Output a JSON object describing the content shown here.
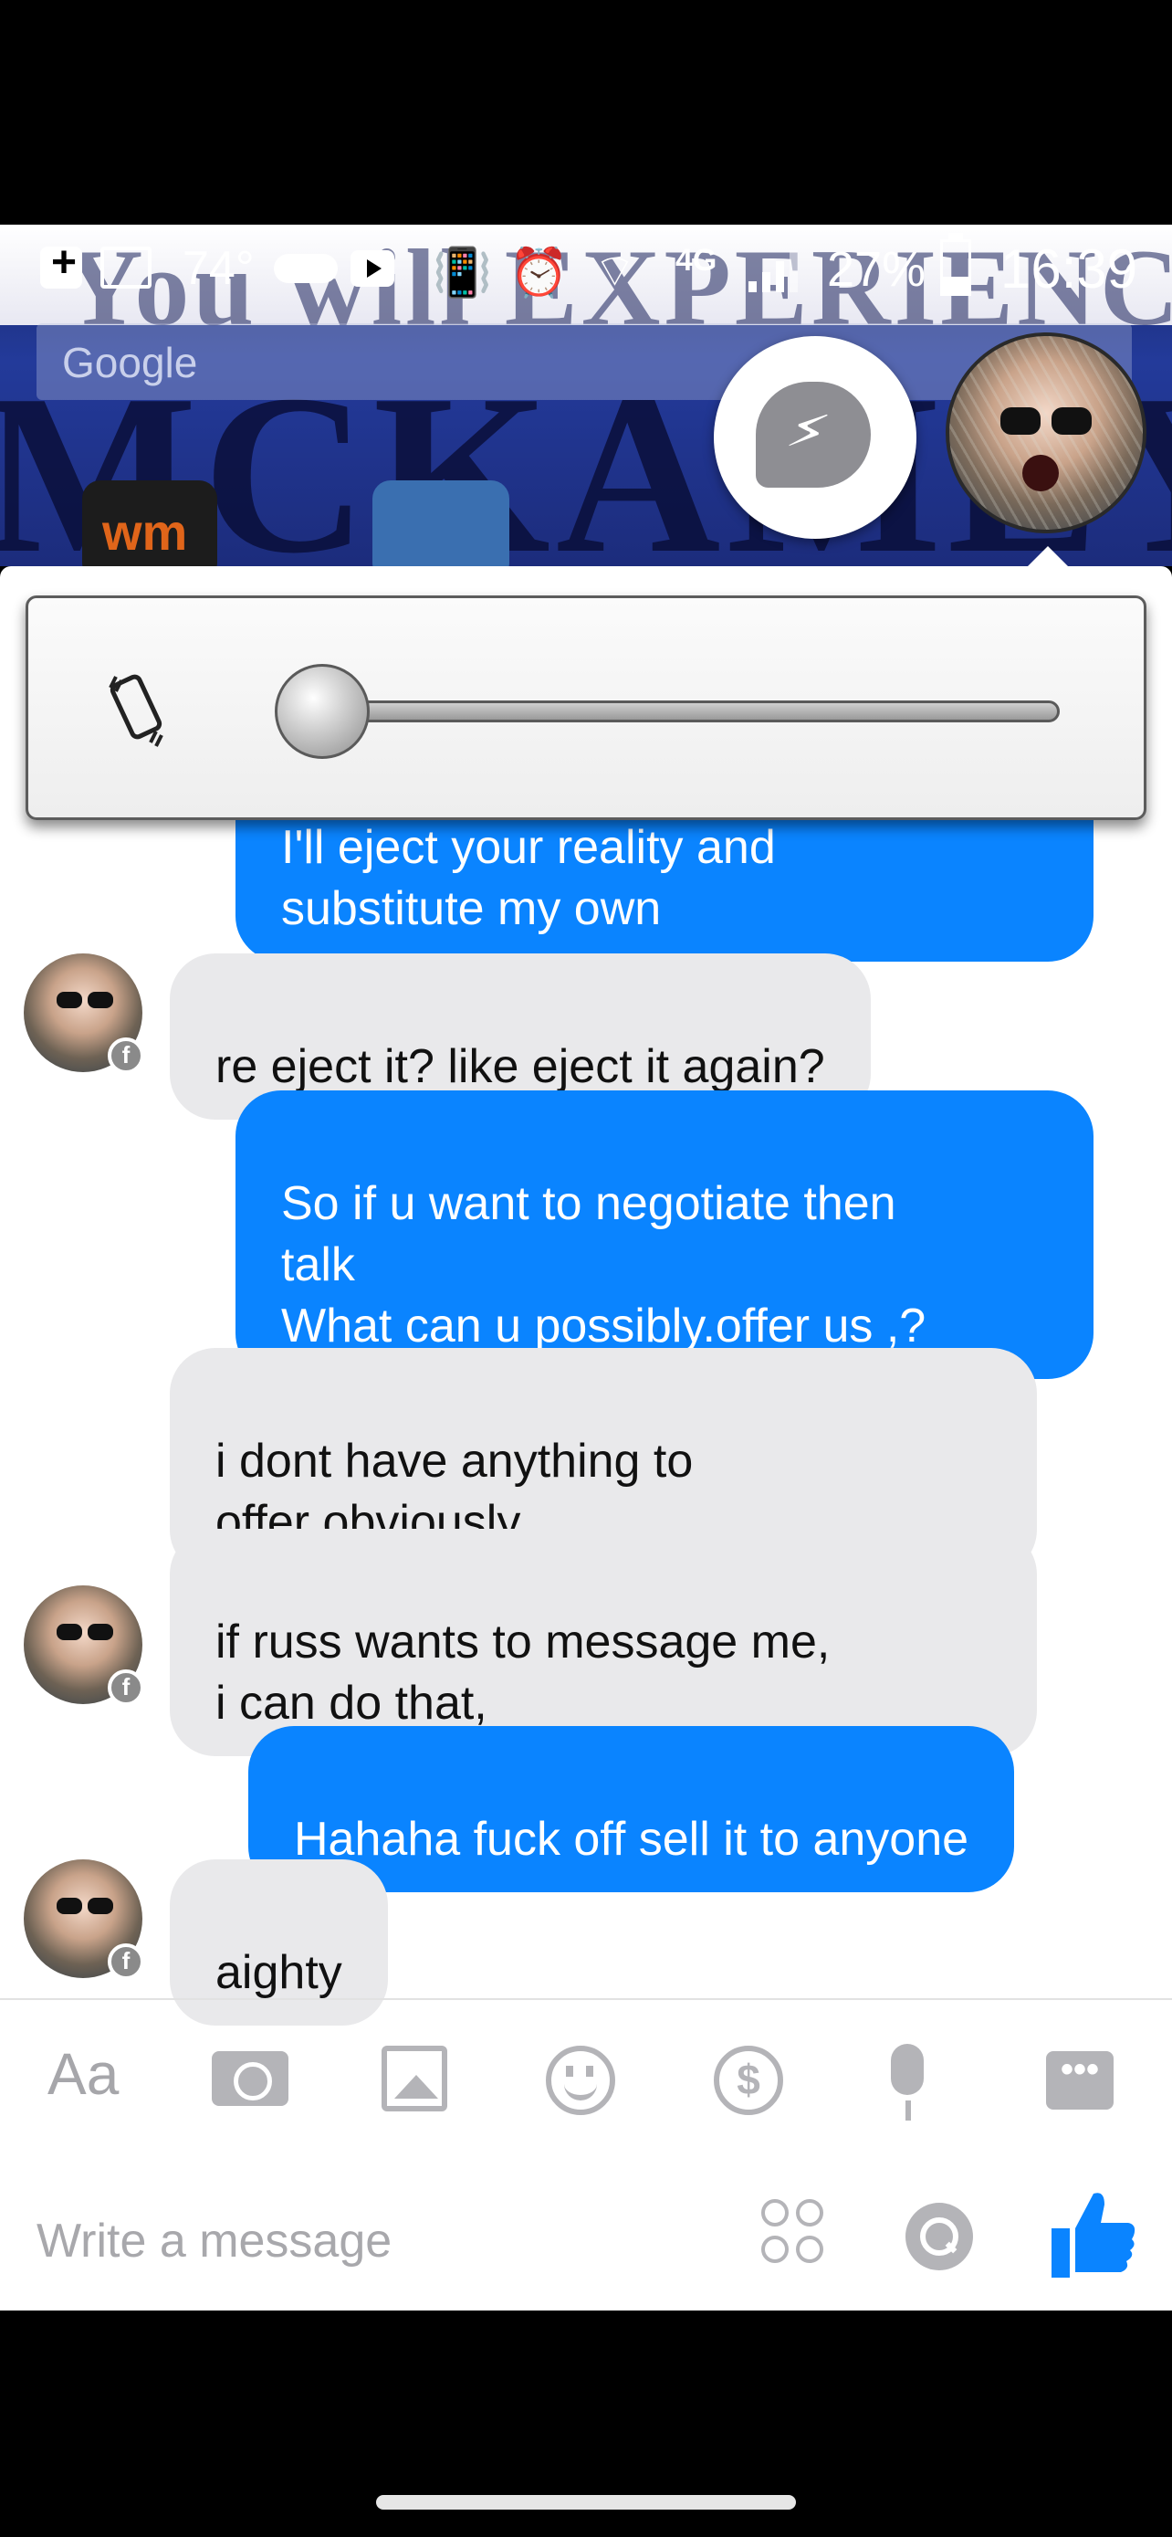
{
  "status_bar": {
    "temperature": "74°",
    "network": "4G",
    "battery": "27%",
    "time": "16:39"
  },
  "wallpaper": {
    "banner_text": "You will EXPERIENCE",
    "big_text": "MCKAMEY",
    "search_placeholder": "Google",
    "app_label": "wm"
  },
  "chat_heads": {
    "messenger": "messenger-icon",
    "contact": "contact-avatar"
  },
  "volume": {
    "mode_icon": "vibrate-icon",
    "level": 0
  },
  "messages": [
    {
      "side": "out",
      "text": "I'll eject your reality and\nsubstitute my own"
    },
    {
      "side": "in",
      "text": "re eject it?  like eject it again?"
    },
    {
      "side": "out",
      "text": "So if u want to negotiate then\ntalk\nWhat can u possibly.offer us ,?"
    },
    {
      "side": "in",
      "text": "i dont have anything to\noffer obviously"
    },
    {
      "side": "in",
      "text": "if russ wants to message me,\ni can do that,"
    },
    {
      "side": "out",
      "text": "Hahaha fuck off sell it to anyone"
    },
    {
      "side": "in",
      "text": "aighty"
    }
  ],
  "toolbar": {
    "aa_label": "Aa",
    "more_label": "•••"
  },
  "composer": {
    "placeholder": "Write a message"
  },
  "colors": {
    "outgoing": "#0a84ff",
    "incoming": "#e9e9eb",
    "like": "#0a84ff"
  }
}
